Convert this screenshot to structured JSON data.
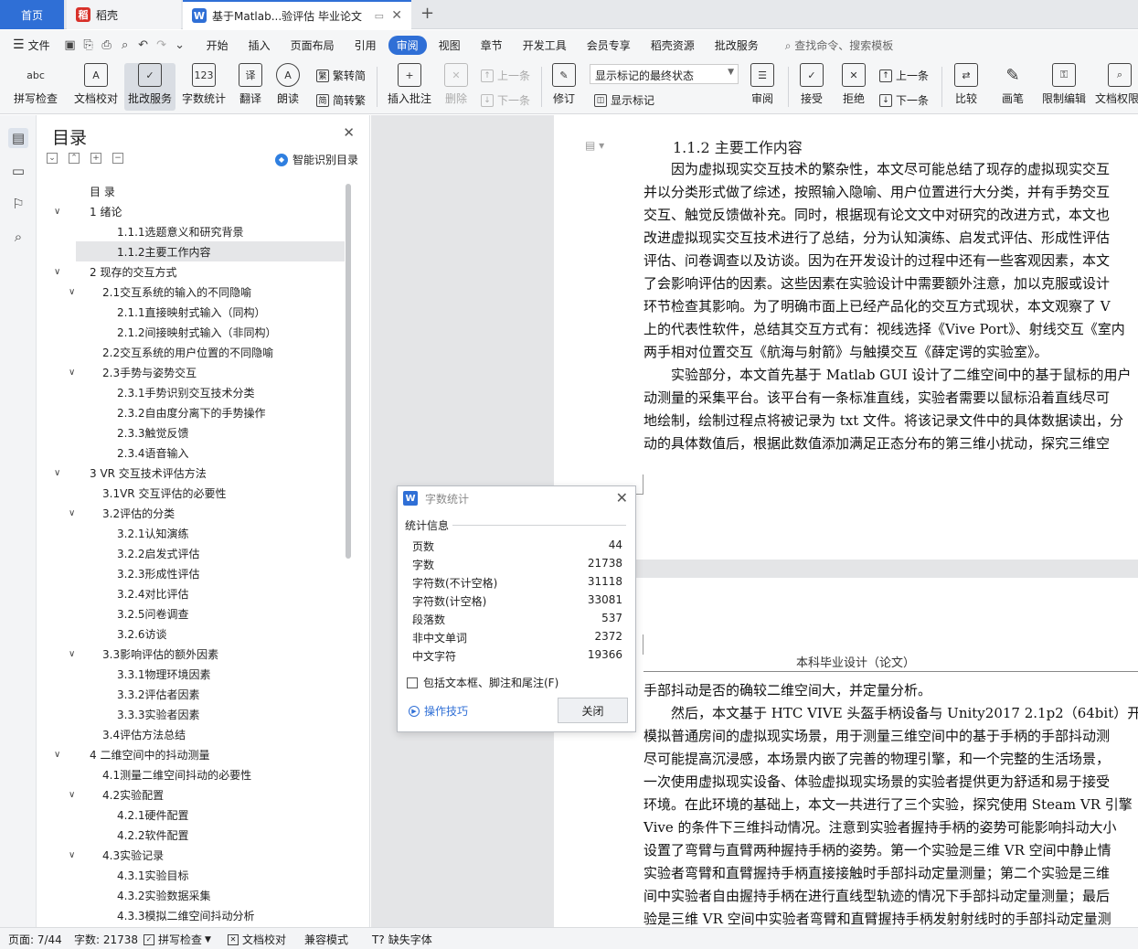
{
  "tabs": {
    "home": "首页",
    "daoke": "稻壳",
    "doc": "基于Matlab...验评估 毕业论文"
  },
  "menubar": {
    "file": "文件",
    "items": [
      "开始",
      "插入",
      "页面布局",
      "引用",
      "审阅",
      "视图",
      "章节",
      "开发工具",
      "会员专享",
      "稻壳资源",
      "批改服务"
    ],
    "active": "审阅",
    "search": "查找命令、搜索模板"
  },
  "ribbon": {
    "spellcheck": "拼写检查",
    "doc_proof": "文档校对",
    "correction_service": "批改服务",
    "word_count": "字数统计",
    "translate": "翻译",
    "read_aloud": "朗读",
    "trad_convert": "繁转简",
    "simp_convert": "简转繁",
    "insert_comment": "插入批注",
    "delete": "删除",
    "prev": "上一条",
    "next": "下一条",
    "revise": "修订",
    "markup_state": "显示标记的最终状态",
    "show_markup": "显示标记",
    "review": "审阅",
    "accept": "接受",
    "reject": "拒绝",
    "prev2": "上一条",
    "next2": "下一条",
    "compare": "比较",
    "pen": "画笔",
    "restrict_edit": "限制编辑",
    "doc_perm": "文档权限"
  },
  "toc": {
    "title": "目录",
    "ai_label": "智能识别目录",
    "items": [
      {
        "text": "目  录",
        "level": 0,
        "arrow": ""
      },
      {
        "text": "1   绪论",
        "level": 0,
        "arrow": "v"
      },
      {
        "text": "1.1.1选题意义和研究背景",
        "level": 2,
        "arrow": ""
      },
      {
        "text": "1.1.2主要工作内容",
        "level": 2,
        "arrow": "",
        "selected": true
      },
      {
        "text": "2   现存的交互方式",
        "level": 0,
        "arrow": "v"
      },
      {
        "text": "2.1交互系统的输入的不同隐喻",
        "level": 1,
        "arrow": "v"
      },
      {
        "text": "2.1.1直接映射式输入（同构）",
        "level": 2,
        "arrow": ""
      },
      {
        "text": "2.1.2间接映射式输入（非同构）",
        "level": 2,
        "arrow": ""
      },
      {
        "text": "2.2交互系统的用户位置的不同隐喻",
        "level": 1,
        "arrow": ""
      },
      {
        "text": "2.3手势与姿势交互",
        "level": 1,
        "arrow": "v"
      },
      {
        "text": "2.3.1手势识别交互技术分类",
        "level": 2,
        "arrow": ""
      },
      {
        "text": "2.3.2自由度分离下的手势操作",
        "level": 2,
        "arrow": ""
      },
      {
        "text": "2.3.3触觉反馈",
        "level": 2,
        "arrow": ""
      },
      {
        "text": "2.3.4语音输入",
        "level": 2,
        "arrow": ""
      },
      {
        "text": "3   VR 交互技术评估方法",
        "level": 0,
        "arrow": "v"
      },
      {
        "text": "3.1VR 交互评估的必要性",
        "level": 1,
        "arrow": ""
      },
      {
        "text": "3.2评估的分类",
        "level": 1,
        "arrow": "v"
      },
      {
        "text": "3.2.1认知演练",
        "level": 2,
        "arrow": ""
      },
      {
        "text": "3.2.2启发式评估",
        "level": 2,
        "arrow": ""
      },
      {
        "text": "3.2.3形成性评估",
        "level": 2,
        "arrow": ""
      },
      {
        "text": "3.2.4对比评估",
        "level": 2,
        "arrow": ""
      },
      {
        "text": "3.2.5问卷调查",
        "level": 2,
        "arrow": ""
      },
      {
        "text": "3.2.6访谈",
        "level": 2,
        "arrow": ""
      },
      {
        "text": "3.3影响评估的额外因素",
        "level": 1,
        "arrow": "v"
      },
      {
        "text": "3.3.1物理环境因素",
        "level": 2,
        "arrow": ""
      },
      {
        "text": "3.3.2评估者因素",
        "level": 2,
        "arrow": ""
      },
      {
        "text": "3.3.3实验者因素",
        "level": 2,
        "arrow": ""
      },
      {
        "text": "3.4评估方法总结",
        "level": 1,
        "arrow": ""
      },
      {
        "text": "4   二维空间中的抖动测量",
        "level": 0,
        "arrow": "v"
      },
      {
        "text": "4.1测量二维空间抖动的必要性",
        "level": 1,
        "arrow": ""
      },
      {
        "text": "4.2实验配置",
        "level": 1,
        "arrow": "v"
      },
      {
        "text": "4.2.1硬件配置",
        "level": 2,
        "arrow": ""
      },
      {
        "text": "4.2.2软件配置",
        "level": 2,
        "arrow": ""
      },
      {
        "text": "4.3实验记录",
        "level": 1,
        "arrow": "v"
      },
      {
        "text": "4.3.1实验目标",
        "level": 2,
        "arrow": ""
      },
      {
        "text": "4.3.2实验数据采集",
        "level": 2,
        "arrow": ""
      },
      {
        "text": "4.3.3模拟二维空间抖动分析",
        "level": 2,
        "arrow": ""
      }
    ]
  },
  "document": {
    "heading": "1.1.2  主要工作内容",
    "page1_lines": [
      "　　因为虚拟现实交互技术的繁杂性，本文尽可能总结了现存的虚拟现实交互",
      "并以分类形式做了综述，按照输入隐喻、用户位置进行大分类，并有手势交互",
      "交互、触觉反馈做补充。同时，根据现有论文文中对研究的改进方式，本文也",
      "改进虚拟现实交互技术进行了总结，分为认知演练、启发式评估、形成性评估",
      "评估、问卷调查以及访谈。因为在开发设计的过程中还有一些客观因素，本文",
      "了会影响评估的因素。这些因素在实验设计中需要额外注意，加以克服或设计",
      "环节检查其影响。为了明确市面上已经产品化的交互方式现状，本文观察了 V",
      "上的代表性软件，总结其交互方式有：视线选择《Vive Port》、射线交互《室内",
      "两手相对位置交互《航海与射箭》与触摸交互《薛定谔的实验室》。",
      "　　实验部分，本文首先基于 Matlab GUI 设计了二维空间中的基于鼠标的用户",
      "动测量的采集平台。该平台有一条标准直线，实验者需要以鼠标沿着直线尽可",
      "地绘制，绘制过程点将被记录为 txt 文件。将该记录文件中的具体数据读出，分",
      "动的具体数值后，根据此数值添加满足正态分布的第三维小扰动，探究三维空"
    ],
    "page2_header": "本科毕业设计（论文）",
    "page2_lines": [
      "手部抖动是否的确较二维空间大，并定量分析。",
      "　　然后，本文基于 HTC VIVE 头盔手柄设备与 Unity2017 2.1p2（64bit）开发",
      "模拟普通房间的虚拟现实场景，用于测量三维空间中的基于手柄的手部抖动测",
      "尽可能提高沉浸感，本场景内嵌了完善的物理引擎，和一个完整的生活场景，",
      "一次使用虚拟现实设备、体验虚拟现实场景的实验者提供更为舒适和易于接受",
      "环境。在此环境的基础上，本文一共进行了三个实验，探究使用 Steam VR 引擎",
      "Vive 的条件下三维抖动情况。注意到实验者握持手柄的姿势可能影响抖动大小",
      "设置了弯臂与直臂两种握持手柄的姿势。第一个实验是三维 VR 空间中静止情",
      "实验者弯臂和直臂握持手柄直接接触时手部抖动定量测量；第二个实验是三维",
      "间中实验者自由握持手柄在进行直线型轨迹的情况下手部抖动定量测量；最后",
      "验是三维 VR 空间中实验者弯臂和直臂握持手柄发射射线时的手部抖动定量测"
    ]
  },
  "word_count_dialog": {
    "title": "字数统计",
    "section": "统计信息",
    "rows": [
      {
        "label": "页数",
        "value": "44"
      },
      {
        "label": "字数",
        "value": "21738"
      },
      {
        "label": "字符数(不计空格)",
        "value": "31118"
      },
      {
        "label": "字符数(计空格)",
        "value": "33081"
      },
      {
        "label": "段落数",
        "value": "537"
      },
      {
        "label": "非中文单词",
        "value": "2372"
      },
      {
        "label": "中文字符",
        "value": "19366"
      }
    ],
    "checkbox_label": "包括文本框、脚注和尾注(F)",
    "tips": "操作技巧",
    "close_button": "关闭"
  },
  "statusbar": {
    "page": "页面: 7/44",
    "words": "字数: 21738",
    "spellcheck": "拼写检查",
    "doc_proof": "文档校对",
    "compat": "兼容模式",
    "missing_font": "缺失字体"
  }
}
